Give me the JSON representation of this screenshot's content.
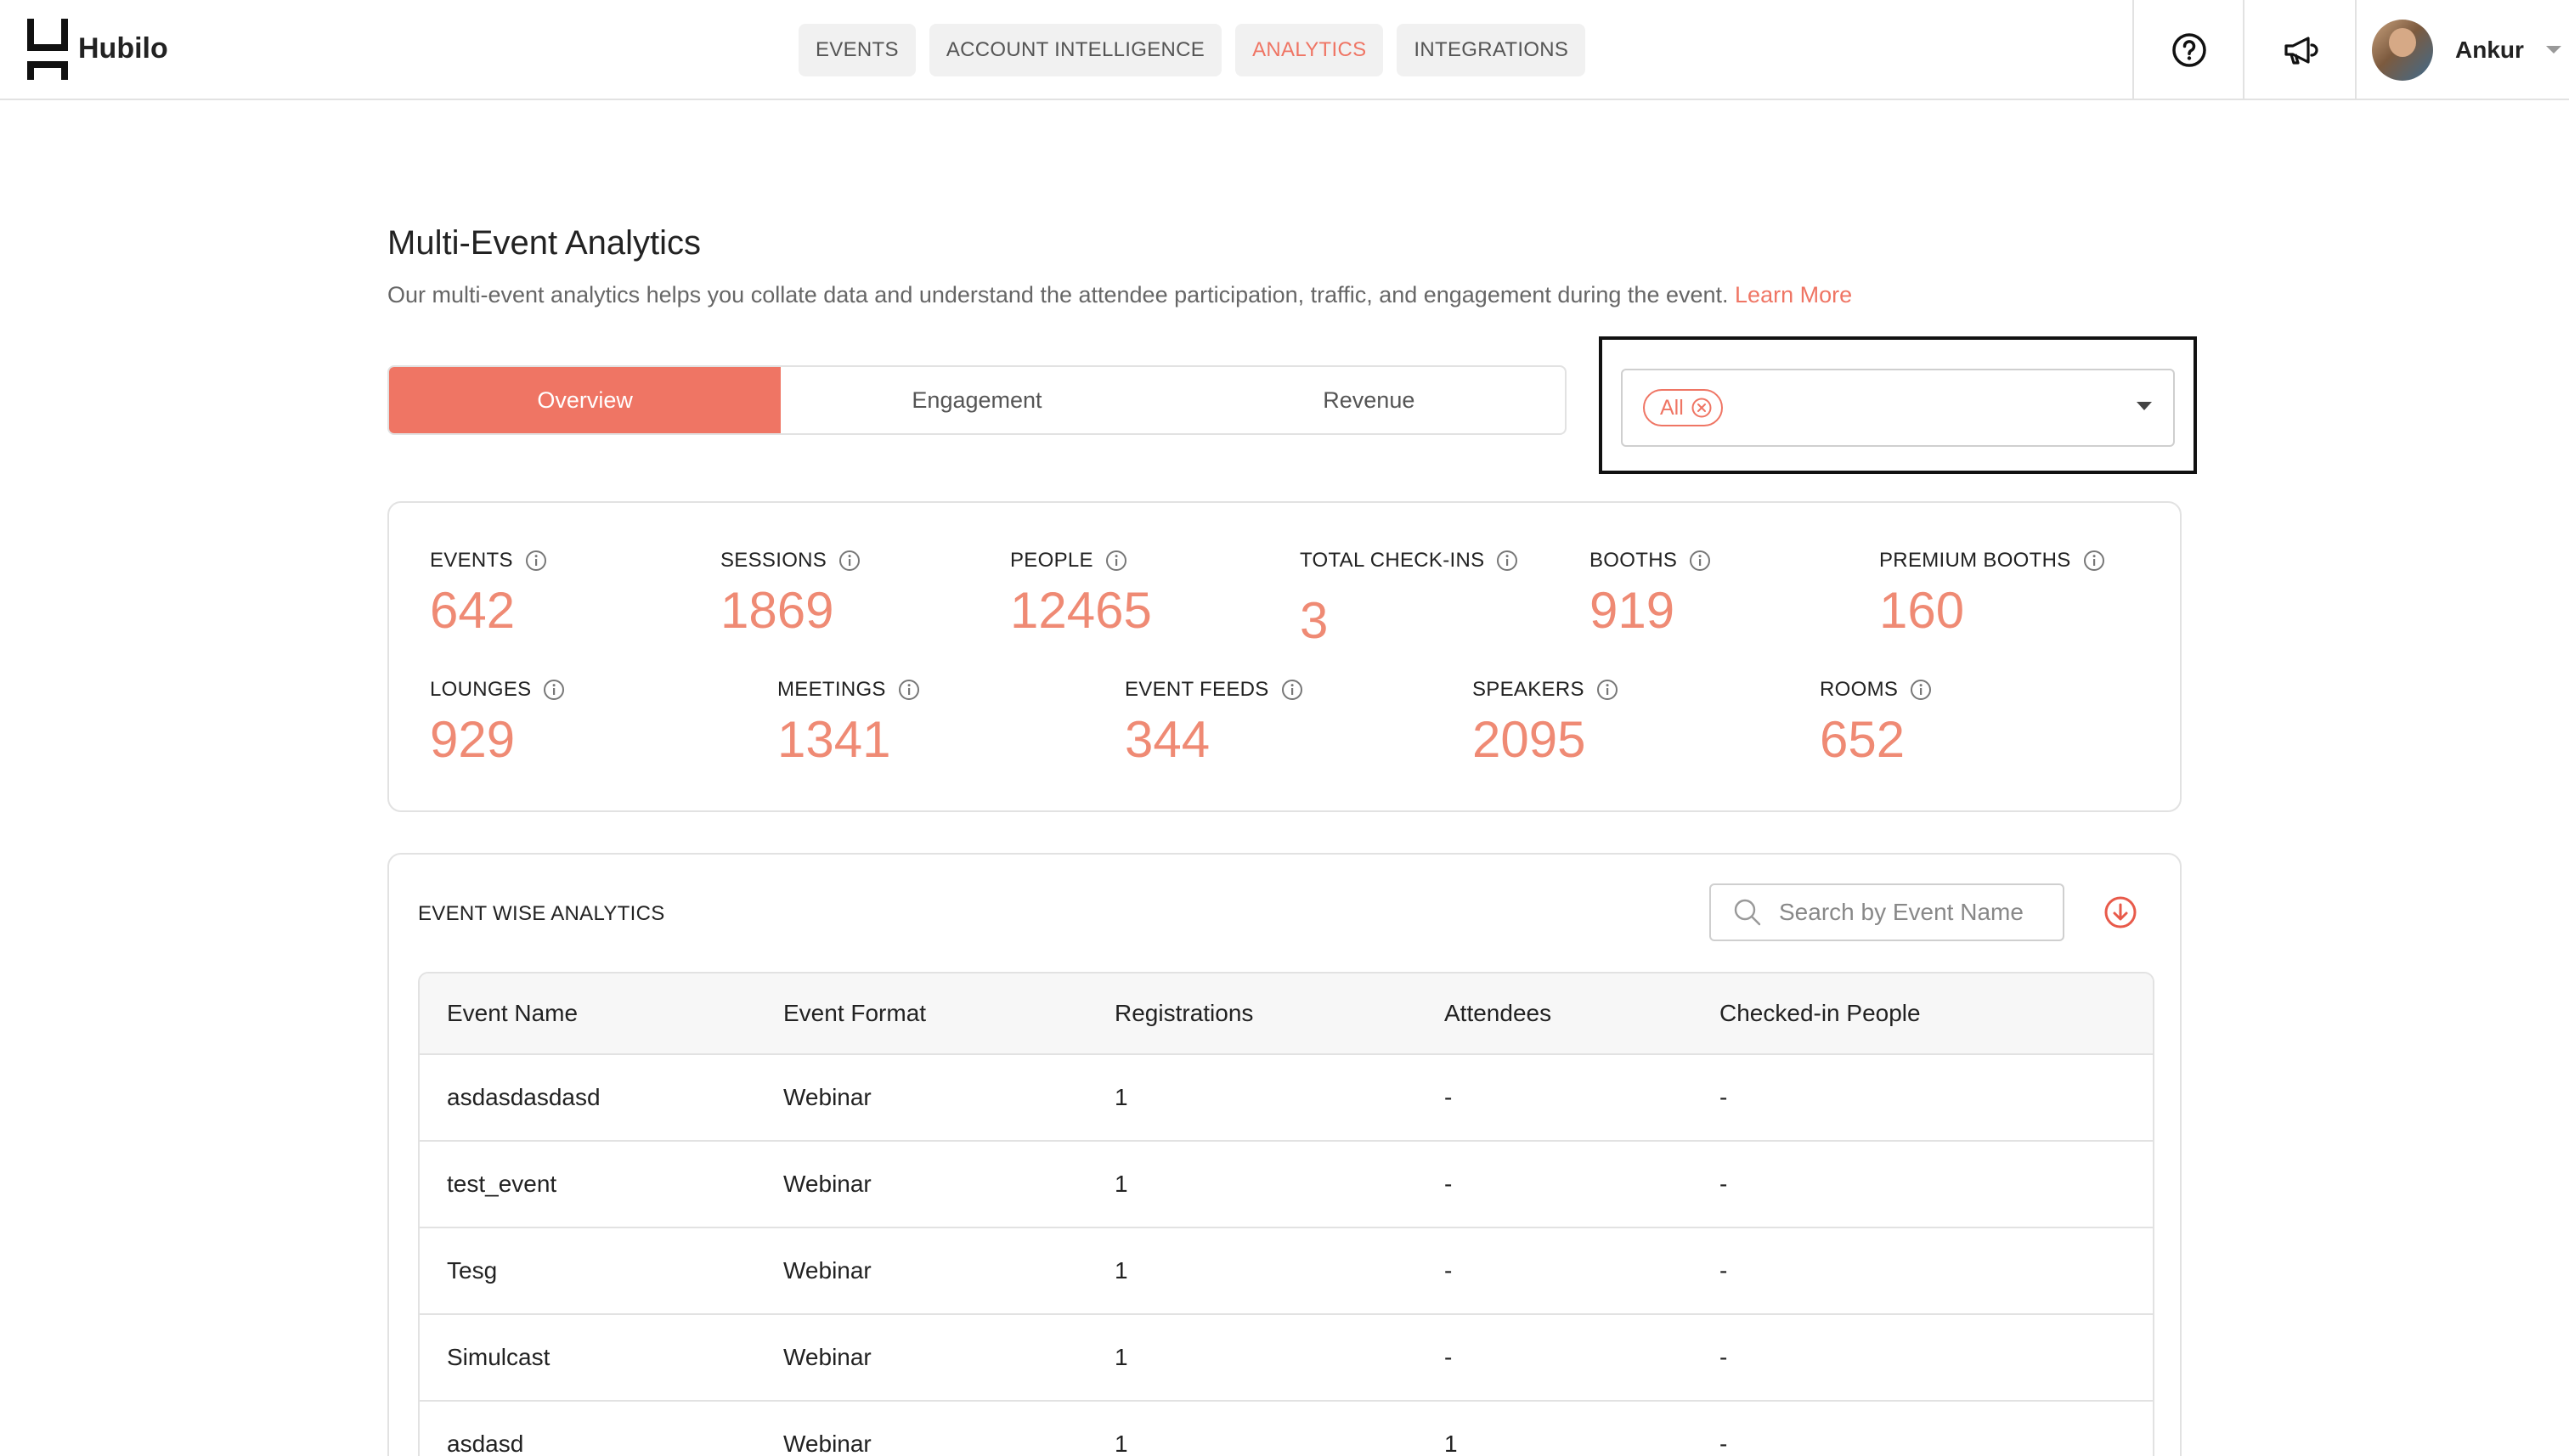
{
  "brand": {
    "name": "Hubilo"
  },
  "nav": [
    {
      "label": "EVENTS",
      "active": false
    },
    {
      "label": "ACCOUNT INTELLIGENCE",
      "active": false
    },
    {
      "label": "ANALYTICS",
      "active": true
    },
    {
      "label": "INTEGRATIONS",
      "active": false
    }
  ],
  "header": {
    "help_icon": "help-circle-icon",
    "announce_icon": "megaphone-icon",
    "user_name": "Ankur"
  },
  "page": {
    "title": "Multi-Event Analytics",
    "description": "Our multi-event analytics helps you collate data and understand the attendee participation, traffic, and engagement during the event.",
    "learn_more": "Learn More"
  },
  "tabs": [
    {
      "label": "Overview",
      "active": true
    },
    {
      "label": "Engagement",
      "active": false
    },
    {
      "label": "Revenue",
      "active": false
    }
  ],
  "event_filter": {
    "selected_chip": "All"
  },
  "stats": [
    {
      "label": "EVENTS",
      "value": "642"
    },
    {
      "label": "SESSIONS",
      "value": "1869"
    },
    {
      "label": "PEOPLE",
      "value": "12465"
    },
    {
      "label": "TOTAL CHECK-INS",
      "value": "3"
    },
    {
      "label": "BOOTHS",
      "value": "919"
    },
    {
      "label": "PREMIUM BOOTHS",
      "value": "160"
    },
    {
      "label": "LOUNGES",
      "value": "929"
    },
    {
      "label": "MEETINGS",
      "value": "1341"
    },
    {
      "label": "EVENT FEEDS",
      "value": "344"
    },
    {
      "label": "SPEAKERS",
      "value": "2095"
    },
    {
      "label": "ROOMS",
      "value": "652"
    }
  ],
  "event_table": {
    "title": "EVENT WISE ANALYTICS",
    "search_placeholder": "Search by Event Name",
    "columns": [
      "Event Name",
      "Event Format",
      "Registrations",
      "Attendees",
      "Checked-in People"
    ],
    "rows": [
      [
        "asdasdasdasd",
        "Webinar",
        "1",
        "-",
        "-"
      ],
      [
        "test_event",
        "Webinar",
        "1",
        "-",
        "-"
      ],
      [
        "Tesg",
        "Webinar",
        "1",
        "-",
        "-"
      ],
      [
        "Simulcast",
        "Webinar",
        "1",
        "-",
        "-"
      ],
      [
        "asdasd",
        "Webinar",
        "1",
        "1",
        "-"
      ]
    ]
  },
  "colors": {
    "accent": "#ef7564",
    "stat_value": "#ef8a74",
    "border": "#e2e2e2"
  }
}
